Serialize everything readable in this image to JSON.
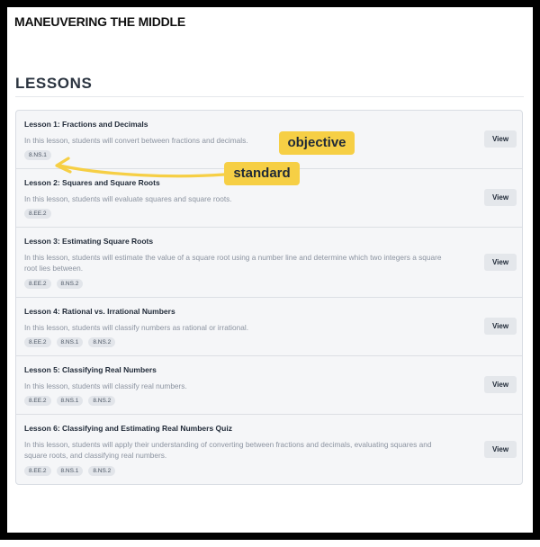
{
  "brand": "MANEUVERING THE MIDDLE",
  "heading": "LESSONS",
  "view_label": "View",
  "lessons": [
    {
      "title": "Lesson 1: Fractions and Decimals",
      "description": "In this lesson, students will convert between fractions and decimals.",
      "standards": [
        "8.NS.1"
      ]
    },
    {
      "title": "Lesson 2: Squares and Square Roots",
      "description": "In this lesson, students will evaluate squares and square roots.",
      "standards": [
        "8.EE.2"
      ]
    },
    {
      "title": "Lesson 3: Estimating Square Roots",
      "description": "In this lesson, students will estimate the value of a square root using a number line and determine which two integers a square root lies between.",
      "standards": [
        "8.EE.2",
        "8.NS.2"
      ]
    },
    {
      "title": "Lesson 4: Rational vs. Irrational Numbers",
      "description": "In this lesson, students will classify numbers as rational or irrational.",
      "standards": [
        "8.EE.2",
        "8.NS.1",
        "8.NS.2"
      ]
    },
    {
      "title": "Lesson 5: Classifying Real Numbers",
      "description": "In this lesson, students will classify real numbers.",
      "standards": [
        "8.EE.2",
        "8.NS.1",
        "8.NS.2"
      ]
    },
    {
      "title": "Lesson 6: Classifying and Estimating Real Numbers Quiz",
      "description": "In this lesson, students will apply their understanding of converting between fractions and decimals, evaluating squares and square roots, and classifying real numbers.",
      "standards": [
        "8.EE.2",
        "8.NS.1",
        "8.NS.2"
      ]
    }
  ],
  "annotations": {
    "objective": "objective",
    "standard": "standard"
  },
  "colors": {
    "callout": "#f6cf45",
    "arrow": "#f6cf45"
  }
}
